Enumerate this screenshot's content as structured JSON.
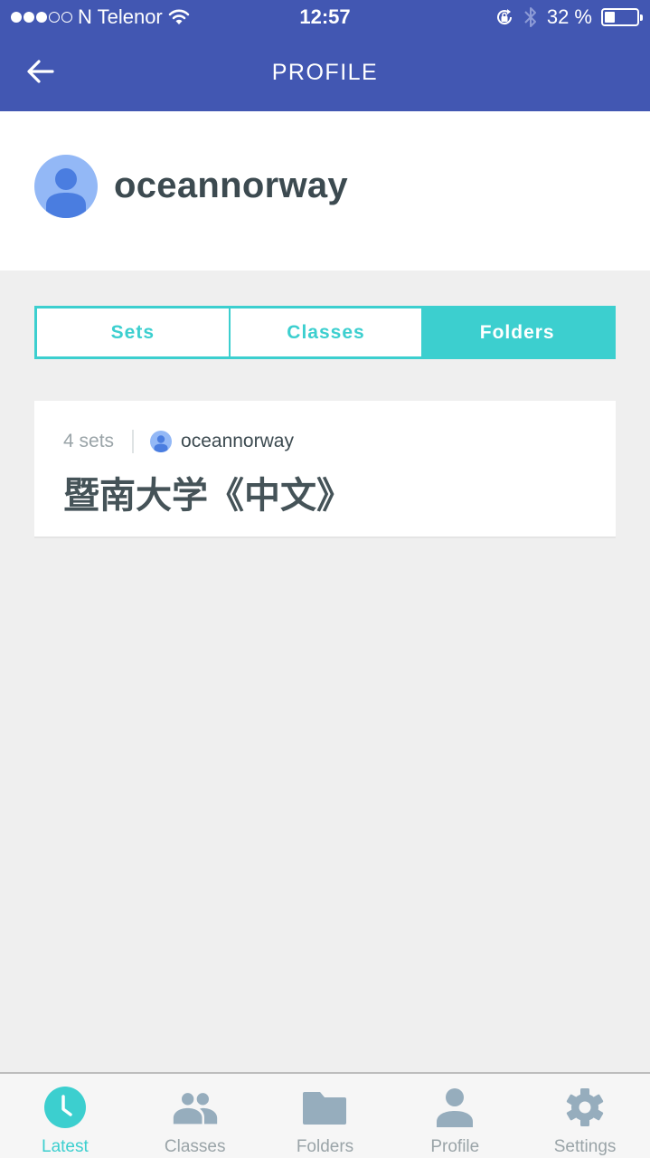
{
  "status_bar": {
    "signal_full": 3,
    "signal_total": 5,
    "carrier": "N Telenor",
    "time": "12:57",
    "battery_text": "32 %",
    "battery_level": 0.32,
    "icons": [
      "wifi-icon",
      "rotation-lock-icon",
      "bluetooth-icon",
      "battery-icon"
    ]
  },
  "header": {
    "title": "PROFILE",
    "back_icon": "arrow-left-icon"
  },
  "profile": {
    "username": "oceannorway",
    "avatar_icon": "person-icon"
  },
  "tabs": [
    {
      "label": "Sets",
      "active": false
    },
    {
      "label": "Classes",
      "active": false
    },
    {
      "label": "Folders",
      "active": true
    }
  ],
  "folders": [
    {
      "set_count": "4 sets",
      "owner": "oceannorway",
      "title": "暨南大学《中文》"
    }
  ],
  "tabbar": {
    "items": [
      {
        "label": "Latest",
        "icon": "clock-icon",
        "active": true
      },
      {
        "label": "Classes",
        "icon": "people-icon",
        "active": false
      },
      {
        "label": "Folders",
        "icon": "folder-icon",
        "active": false
      },
      {
        "label": "Profile",
        "icon": "person-icon",
        "active": false
      },
      {
        "label": "Settings",
        "icon": "gear-icon",
        "active": false
      }
    ]
  },
  "colors": {
    "header_bg": "#4257b2",
    "accent": "#3ccfcf",
    "tab_inactive_icon": "#96adbd",
    "avatar_bg": "#93b8f6",
    "avatar_fg": "#4a7de0"
  }
}
